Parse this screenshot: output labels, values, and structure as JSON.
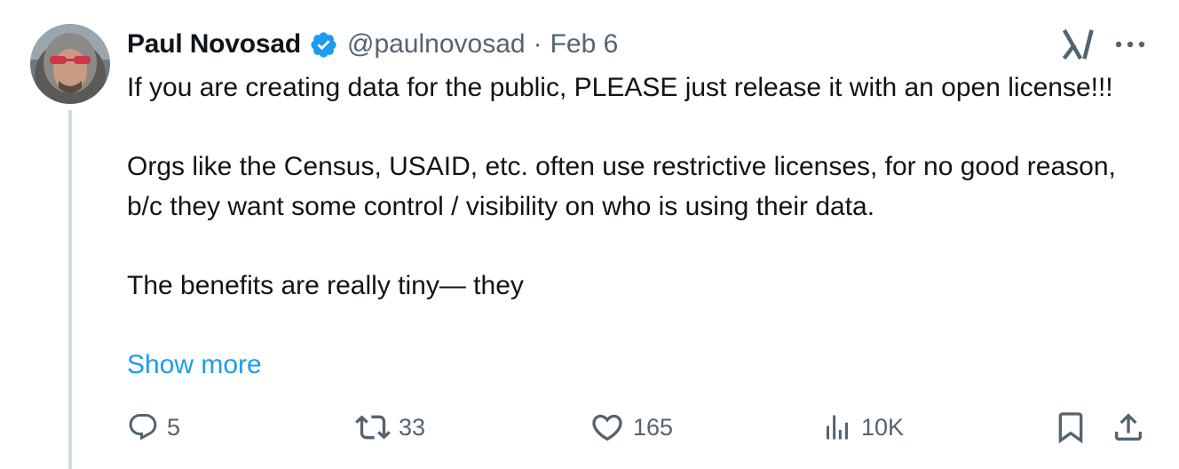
{
  "tweet": {
    "author": {
      "name": "Paul Novosad",
      "handle": "@paulnovosad",
      "verified": true,
      "avatar": "avatar-photo"
    },
    "separator": "·",
    "date": "Feb 6",
    "text": [
      "If you are creating data for the public, PLEASE just release it with an open license!!!",
      "Orgs like the Census, USAID, etc. often use restrictive licenses, for no good reason, b/c they want some control / visibility on who is using their data.",
      "The benefits are really tiny— they"
    ],
    "show_more_label": "Show more",
    "actions": {
      "reply": {
        "icon": "reply-icon",
        "count": "5"
      },
      "retweet": {
        "icon": "retweet-icon",
        "count": "33"
      },
      "like": {
        "icon": "heart-icon",
        "count": "165"
      },
      "views": {
        "icon": "analytics-icon",
        "count": "10K"
      },
      "bookmark": {
        "icon": "bookmark-icon"
      },
      "share": {
        "icon": "share-icon"
      }
    },
    "header_icons": [
      "grok-icon",
      "more-icon"
    ]
  },
  "colors": {
    "text": "#0f1419",
    "secondary": "#536471",
    "link": "#1d9bf0",
    "verified": "#1d9bf0",
    "thread_line": "#cfd9de"
  }
}
